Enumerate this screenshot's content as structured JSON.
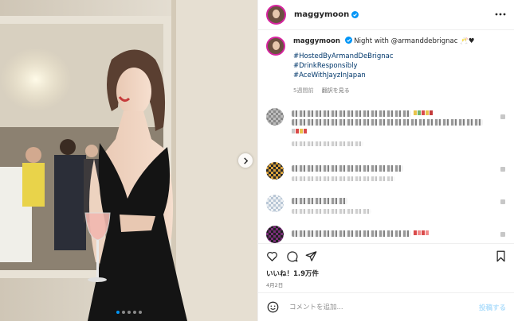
{
  "account": {
    "username": "maggymoon",
    "verified": true
  },
  "caption": {
    "text": "Night with @armanddebrignac 🥂♥",
    "hashtags": [
      "#HostedByArmandDeBrignac",
      "#DrinkResponsibly",
      "#AceWithJayzInJapan"
    ],
    "time_ago": "5週間前",
    "translate": "翻訳を見る"
  },
  "media": {
    "carousel_count": 5,
    "active_index": 0
  },
  "actions": {
    "likes": "いいね！1.9万件",
    "date": "4月2日"
  },
  "comment_box": {
    "placeholder": "コメントを追加...",
    "post_label": "投稿する"
  },
  "icons": {
    "more": "more-horizontal-icon",
    "verified": "verified-badge-icon",
    "like": "heart-outline-icon",
    "comment": "comment-bubble-icon",
    "share": "paper-plane-icon",
    "save": "bookmark-icon",
    "emoji": "smiley-icon",
    "next": "chevron-right-icon"
  },
  "colors": {
    "accent": "#0095f6",
    "link": "#00376b",
    "muted": "#737373",
    "post_disabled": "#b2dffc"
  }
}
